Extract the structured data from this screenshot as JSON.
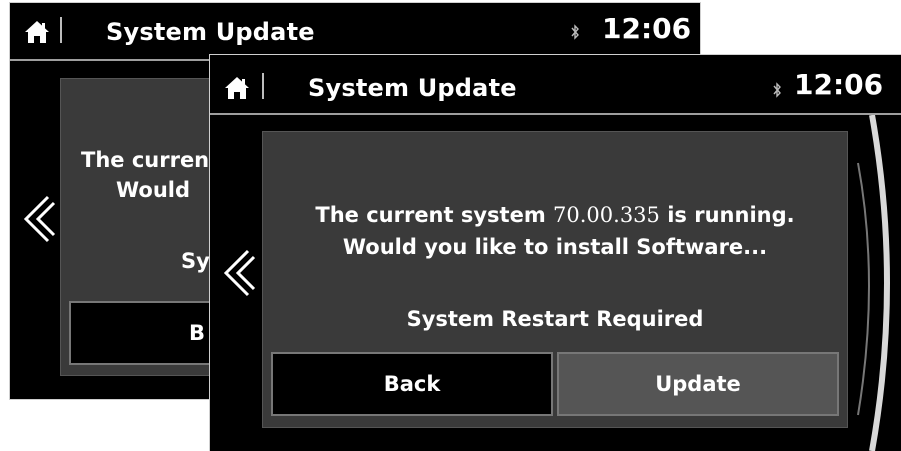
{
  "back_screen": {
    "title": "System Update",
    "time": "12:06",
    "message_line1": "The curren",
    "message_line2": "Would",
    "restart_fragment": "Sy",
    "back_fragment": "B"
  },
  "front_screen": {
    "title": "System Update",
    "time": "12:06",
    "message_prefix": "The current system",
    "version": "70.00.335",
    "message_suffix": "is running.",
    "message_line2": "Would you like to install Software...",
    "restart_notice": "System Restart Required",
    "back_button": "Back",
    "update_button": "Update"
  },
  "icons": {
    "home": "home-icon",
    "bluetooth": "bluetooth-icon",
    "previous": "chevron-left-icon"
  },
  "colors": {
    "screen_bg": "#000000",
    "dialog_bg": "#3a3a3a",
    "update_bg": "#555555",
    "text": "#ffffff"
  }
}
